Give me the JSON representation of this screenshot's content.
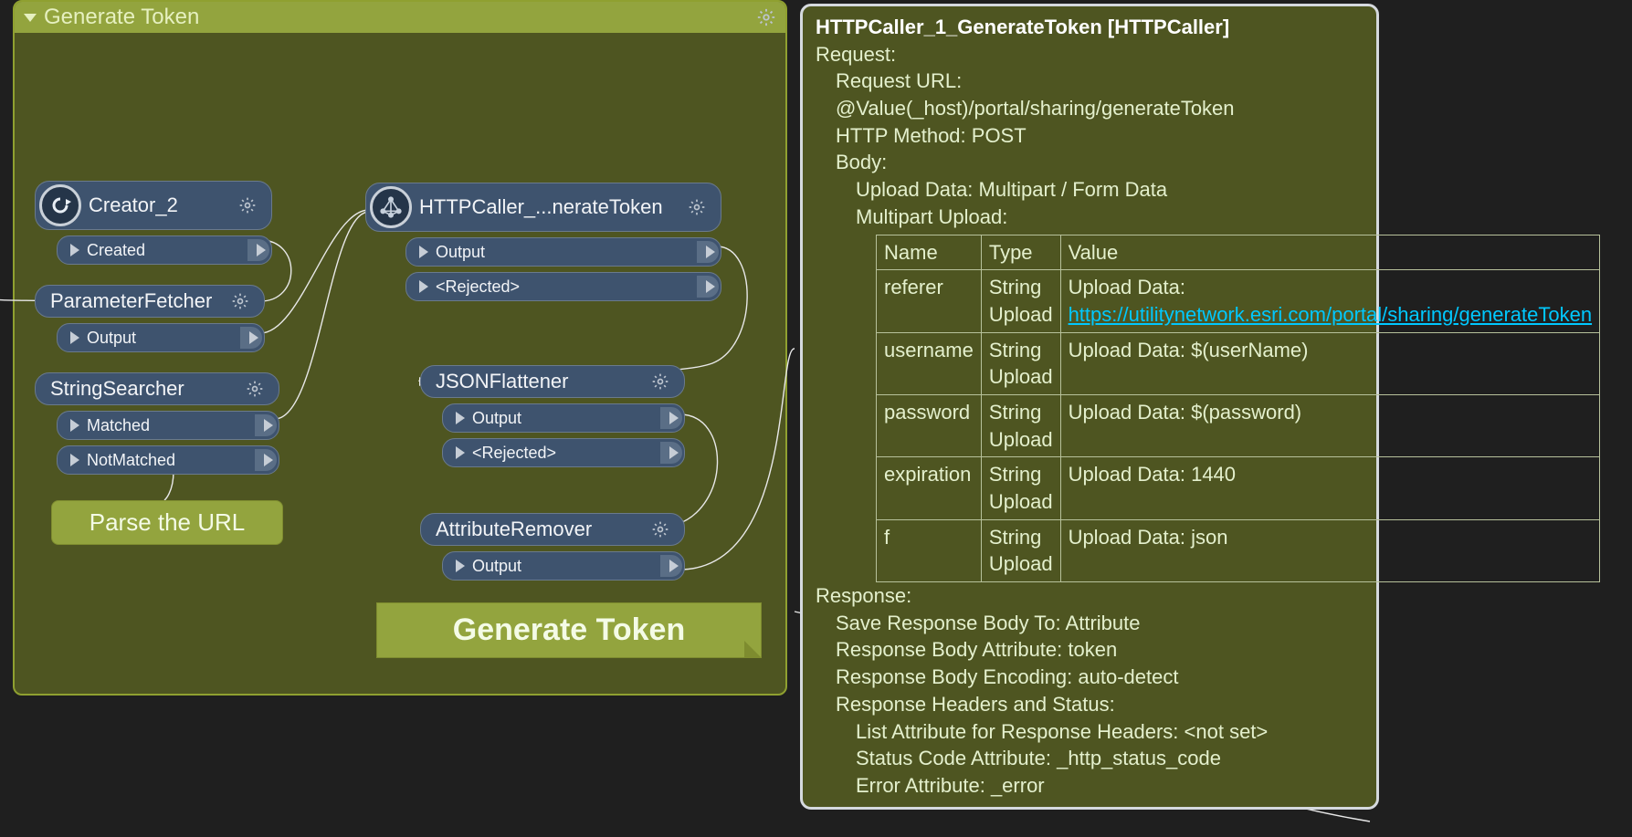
{
  "group": {
    "title": "Generate Token"
  },
  "nodes": {
    "creator": {
      "title": "Creator_2",
      "ports": [
        "Created"
      ]
    },
    "paramFetcher": {
      "title": "ParameterFetcher",
      "ports": [
        "Output"
      ]
    },
    "stringSearcher": {
      "title": "StringSearcher",
      "ports": [
        "Matched",
        "NotMatched"
      ]
    },
    "httpCaller": {
      "title": "HTTPCaller_...nerateToken",
      "ports": [
        "Output",
        "<Rejected>"
      ]
    },
    "jsonFlattener": {
      "title": "JSONFlattener",
      "ports": [
        "Output",
        "<Rejected>"
      ]
    },
    "attrRemover": {
      "title": "AttributeRemover",
      "ports": [
        "Output"
      ]
    }
  },
  "annotation": {
    "parseUrl": "Parse the URL",
    "generate": "Generate Token"
  },
  "info": {
    "title": "HTTPCaller_1_GenerateToken [HTTPCaller]",
    "request_label": "Request:",
    "request_url_label": "Request URL: ",
    "request_url_value": "@Value(_host)/portal/sharing/generateToken",
    "http_method_label": "HTTP Method: ",
    "http_method_value": "POST",
    "body_label": "Body:",
    "upload_data_label": "Upload Data: ",
    "upload_data_value": "Multipart / Form Data",
    "multipart_label": "Multipart Upload:",
    "table": {
      "h1": "Name",
      "h2": "Type",
      "h3": "Value",
      "r1_name": "referer",
      "r1_type": "String Upload",
      "r1_val_prefix": "Upload Data: ",
      "r1_val_link": "https://utilitynetwork.esri.com/portal/sharing/generateToken",
      "r2_name": "username",
      "r2_type": "String Upload",
      "r2_val": "Upload Data: $(userName)",
      "r3_name": "password",
      "r3_type": "String Upload",
      "r3_val": "Upload Data: $(password)",
      "r4_name": "expiration",
      "r4_type": "String Upload",
      "r4_val": "Upload Data: 1440",
      "r5_name": "f",
      "r5_type": "String Upload",
      "r5_val": "Upload Data: json"
    },
    "response_label": "Response:",
    "save_body": "Save Response Body To: Attribute",
    "body_attr": "Response Body Attribute: token",
    "body_enc": "Response Body Encoding: auto-detect",
    "headers_status": "Response Headers and Status:",
    "list_attr": "List Attribute for Response Headers: <not set>",
    "status_attr": "Status Code Attribute: _http_status_code",
    "error_attr": "Error Attribute: _error"
  }
}
